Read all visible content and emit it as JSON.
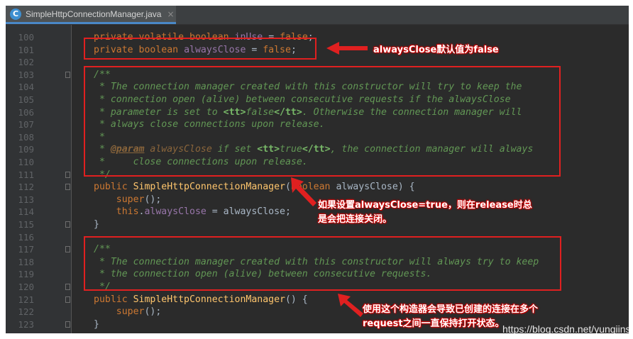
{
  "tab": {
    "icon_letter": "C",
    "file": "SimpleHttpConnectionManager.java",
    "close": "×"
  },
  "lines": [
    {
      "n": "100",
      "html": "<span class='kw'>private</span> <span class='kw'>volatile</span> <span class='kw'>boolean</span> <span class='fld'>inUse</span> = <span class='kw'>false</span>;"
    },
    {
      "n": "101",
      "html": "<span class='kw'>private</span> <span class='kw'>boolean</span> <span class='fld'>alwaysClose</span> = <span class='kw'>false</span>;"
    },
    {
      "n": "102",
      "html": ""
    },
    {
      "n": "103",
      "html": "<span class='doc'>/**</span>",
      "fold": true
    },
    {
      "n": "104",
      "html": "<span class='doc'> * The connection manager created with this constructor will try to keep the</span>"
    },
    {
      "n": "105",
      "html": "<span class='doc'> * connection open (alive) between consecutive requests if the alwaysClose</span>"
    },
    {
      "n": "106",
      "html": "<span class='doc'> * parameter is set to <span class='tag'>&lt;tt&gt;</span>false<span class='tag'>&lt;/tt&gt;</span>. Otherwise the connection manager will</span>"
    },
    {
      "n": "107",
      "html": "<span class='doc'> * always close connections upon release.</span>"
    },
    {
      "n": "108",
      "html": "<span class='doc'> *</span>"
    },
    {
      "n": "109",
      "html": "<span class='doc'> * <span class='pm'>@param</span> <span class='pv'>alwaysClose</span> if set <span class='tag'>&lt;tt&gt;</span>true<span class='tag'>&lt;/tt&gt;</span>, the connection manager will always</span>"
    },
    {
      "n": "110",
      "html": "<span class='doc'> *     close connections upon release.</span>"
    },
    {
      "n": "111",
      "html": "<span class='doc'> */</span>",
      "fold": true
    },
    {
      "n": "112",
      "html": "<span class='kw'>public</span> <span class='fn'>SimpleHttpConnectionManager</span>(<span class='kw'>boolean</span> alwaysClose) {",
      "fold": true
    },
    {
      "n": "113",
      "html": "    <span class='kw'>super</span>();"
    },
    {
      "n": "114",
      "html": "    <span class='kw'>this</span>.<span class='fld'>alwaysClose</span> = alwaysClose;"
    },
    {
      "n": "115",
      "html": "}",
      "fold": true
    },
    {
      "n": "116",
      "html": ""
    },
    {
      "n": "117",
      "html": "<span class='doc'>/**</span>",
      "fold": true
    },
    {
      "n": "118",
      "html": "<span class='doc'> * The connection manager created with this constructor will always try to keep</span>"
    },
    {
      "n": "119",
      "html": "<span class='doc'> * the connection open (alive) between consecutive requests.</span>"
    },
    {
      "n": "120",
      "html": "<span class='doc'> */</span>",
      "fold": true
    },
    {
      "n": "121",
      "html": "<span class='kw'>public</span> <span class='fn'>SimpleHttpConnectionManager</span>() {",
      "fold": true
    },
    {
      "n": "122",
      "html": "    <span class='kw'>super</span>();"
    },
    {
      "n": "123",
      "html": "}",
      "fold": true
    },
    {
      "n": "124",
      "html": ""
    }
  ],
  "annotations": {
    "note1": "alwaysClose默认值为false",
    "note2_line1": "如果设置alwaysClose=true，则在release时总",
    "note2_line2": "是会把连接关闭。",
    "note3_line1": "使用这个构造器会导致已创建的连接在多个",
    "note3_line2": "request之间一直保持打开状态。"
  },
  "watermark": "https://blog.csdn.net/yunqiinsight",
  "colors": {
    "annotation_red": "#e02020",
    "keyword": "#cc7832",
    "doc_comment": "#629755",
    "method": "#ffc66d",
    "field": "#9876aa"
  }
}
